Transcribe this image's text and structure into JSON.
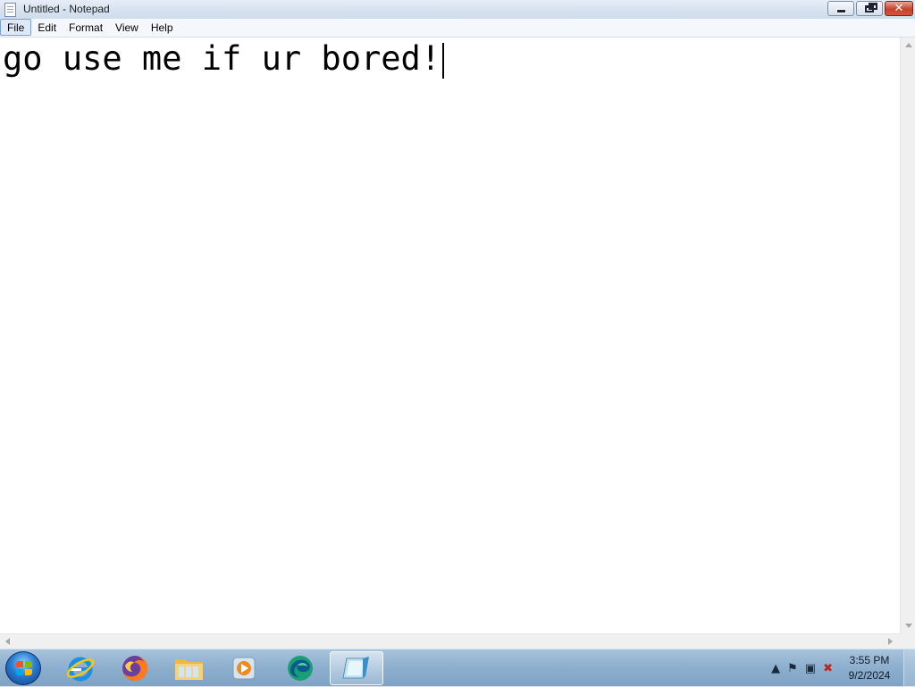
{
  "window": {
    "title": "Untitled - Notepad"
  },
  "menu": {
    "items": [
      "File",
      "Edit",
      "Format",
      "View",
      "Help"
    ]
  },
  "editor": {
    "text": "go use me if ur bored!"
  },
  "taskbar": {
    "apps": [
      "internet-explorer",
      "firefox",
      "file-explorer",
      "media-player",
      "edge",
      "notepad"
    ]
  },
  "tray": {
    "time": "3:55 PM",
    "date": "9/2/2024"
  }
}
